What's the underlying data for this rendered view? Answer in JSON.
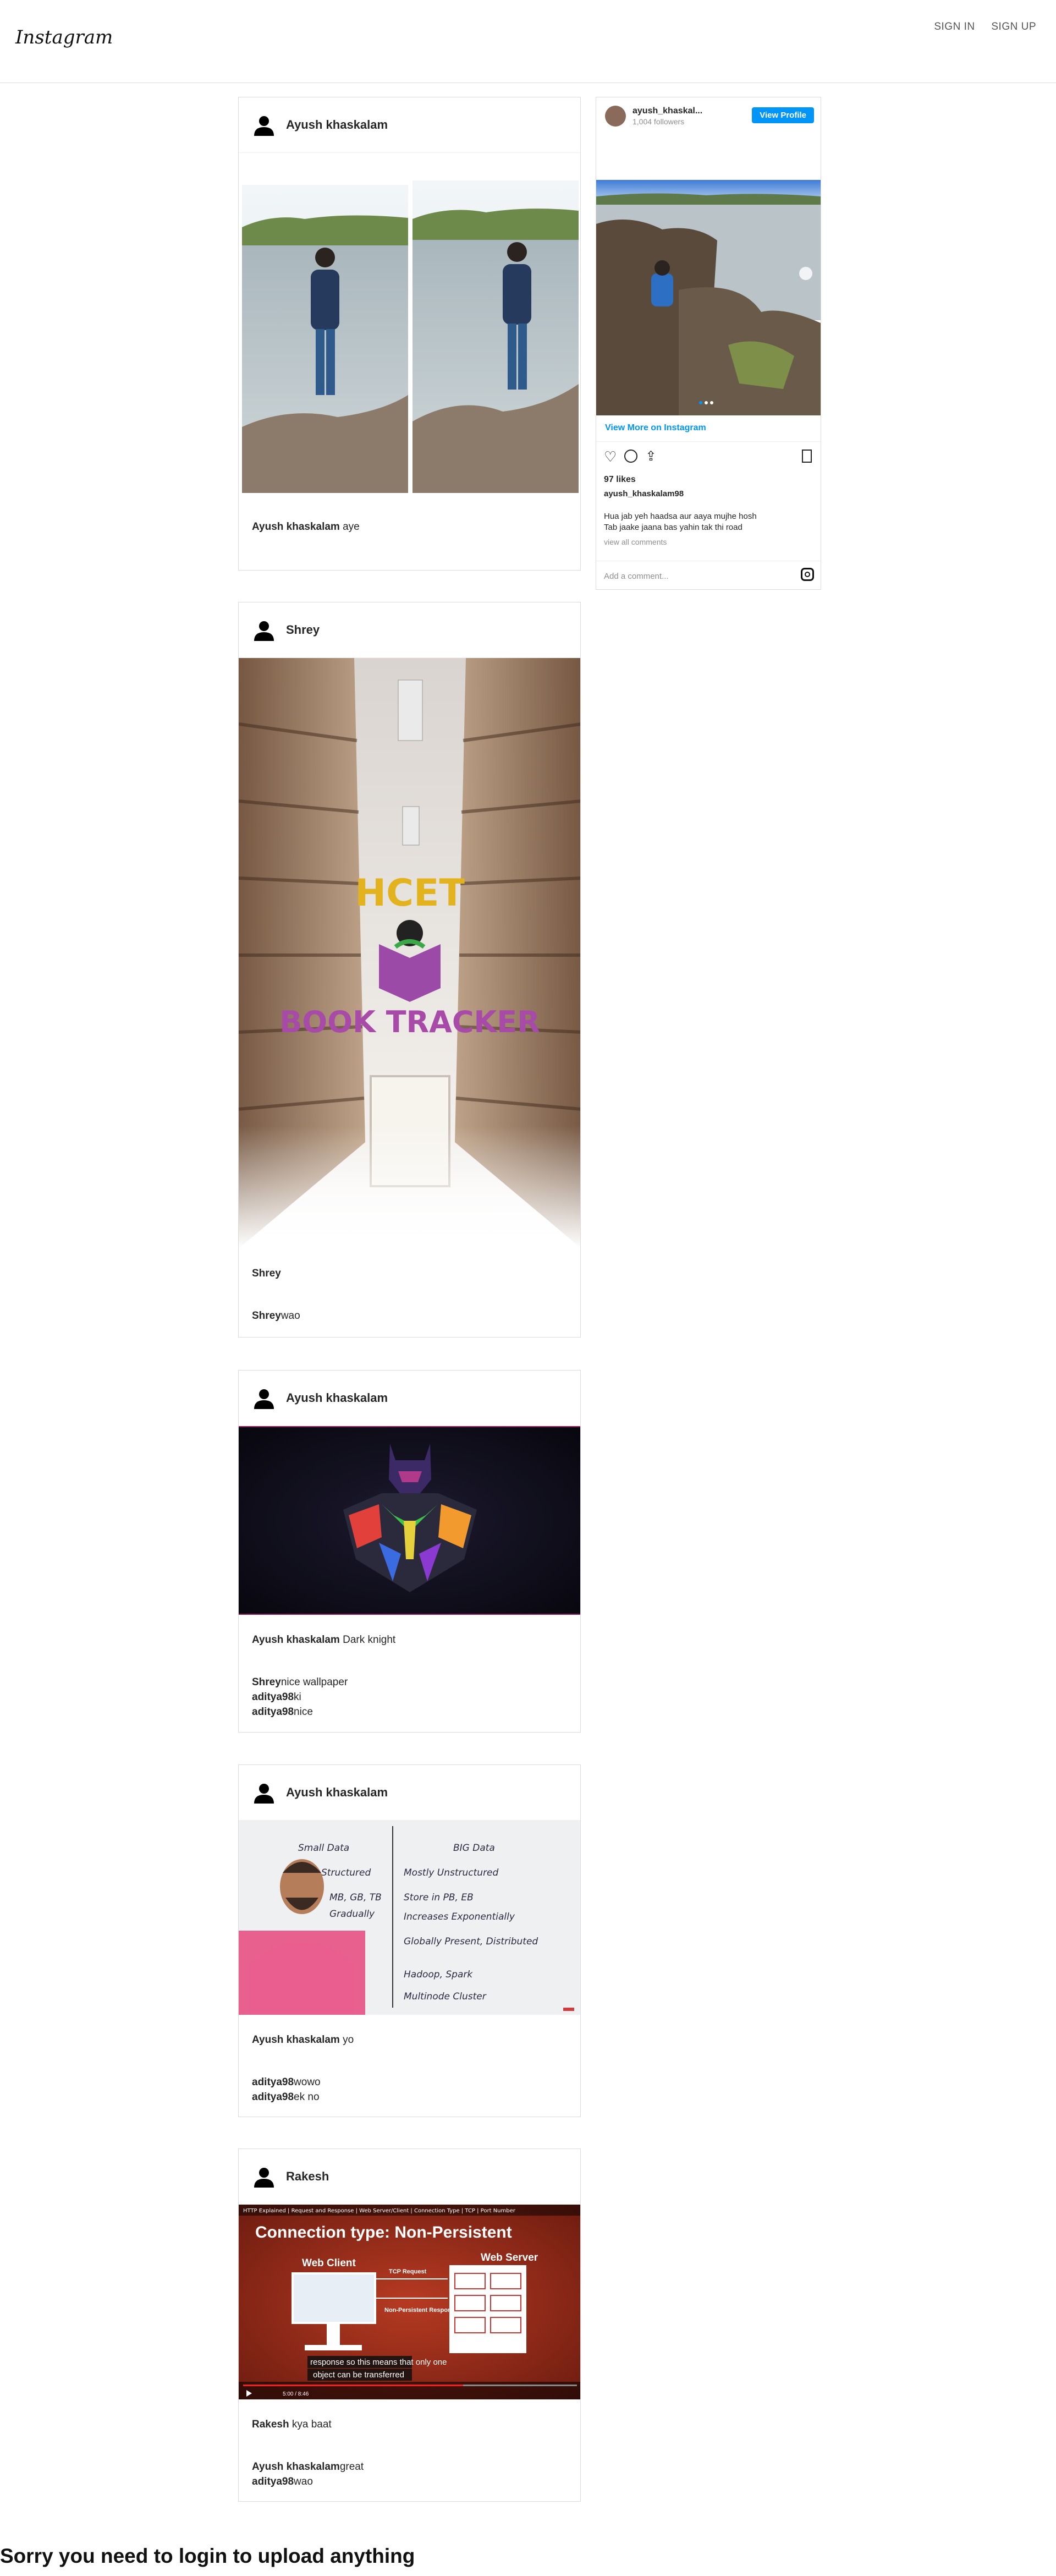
{
  "header": {
    "logo": "Instagram",
    "sign_in": "SIGN IN",
    "sign_up": "SIGN UP"
  },
  "posts": [
    {
      "user": "Ayush khaskalam",
      "caption_user": "Ayush khaskalam",
      "caption_text": " aye",
      "comments": []
    },
    {
      "user": "Shrey",
      "caption_user": "Shrey",
      "caption_text": "",
      "image_text": [
        "HCET",
        "BOOK TRACKER"
      ],
      "comments": [
        {
          "user": "Shrey",
          "text": "wao"
        }
      ]
    },
    {
      "user": "Ayush khaskalam",
      "caption_user": "Ayush khaskalam",
      "caption_text": " Dark knight",
      "comments": [
        {
          "user": "Shrey",
          "text": "nice wallpaper"
        },
        {
          "user": "aditya98",
          "text": "ki"
        },
        {
          "user": "aditya98",
          "text": "nice"
        }
      ]
    },
    {
      "user": "Ayush khaskalam",
      "caption_user": "Ayush khaskalam",
      "caption_text": " yo",
      "board_text": [
        "Small Data",
        "BIG Data",
        "Structured",
        "Mostly Unstructured",
        "MB, GB, TB",
        "Store in PB, EB",
        "Gradually",
        "Increases Exponentially",
        "Globally Present, Distributed",
        "Hadoop, Spark",
        "Multinode Cluster"
      ],
      "comments": [
        {
          "user": "aditya98",
          "text": "wowo"
        },
        {
          "user": "aditya98",
          "text": "ek no"
        }
      ]
    },
    {
      "user": "Rakesh",
      "caption_user": "Rakesh",
      "caption_text": " kya baat",
      "video": {
        "top_bar": "HTTP Explained | Request and Response | Web Server/Client | Connection Type | TCP | Port Number",
        "title": "Connection type: Non-Persistent",
        "web_client": "Web Client",
        "web_server": "Web Server",
        "tcp_request": "TCP Request",
        "non_persistent": "Non-Persistent Response",
        "subtitle_1": "response so this means that only one",
        "subtitle_2": "object can be transferred",
        "time": "5:00 / 8:46"
      },
      "comments": [
        {
          "user": "Ayush khaskalam",
          "text": "great"
        },
        {
          "user": "aditya98",
          "text": "wao"
        }
      ]
    }
  ],
  "embed": {
    "username": "ayush_khaskal...",
    "followers": "1,004 followers",
    "view_profile": "View Profile",
    "view_more": "View More on Instagram",
    "likes": "97 likes",
    "handle": "ayush_khaskalam98",
    "caption_line1": "Hua jab yeh haadsa aur aaya mujhe hosh",
    "caption_line2": "Tab jaake jaana bas yahin tak thi road",
    "view_all": "view all comments",
    "add_comment": "Add a comment..."
  },
  "footer": {
    "message": "Sorry you need to login to upload anything"
  },
  "colors": {
    "accent": "#0095f6",
    "border": "#dbdbdb"
  }
}
